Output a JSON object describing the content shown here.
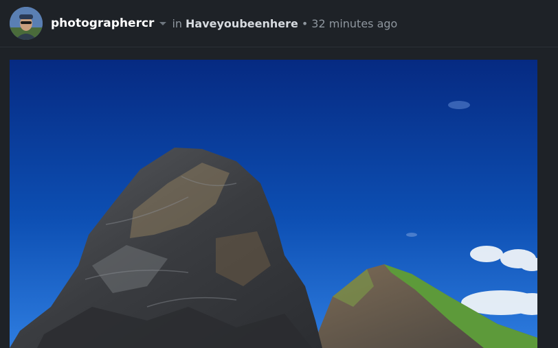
{
  "post": {
    "author": "photographercr",
    "in_label": "in",
    "community": "Haveyoubeenhere",
    "separator": "•",
    "time": "32 minutes ago",
    "avatar_icon": "user-avatar",
    "dropdown_icon": "caret-down-icon",
    "image_subject": "rocky sea stacks under a deep blue sky"
  },
  "colors": {
    "background": "#1e2227",
    "sky_top": "#062a82",
    "sky_bottom": "#2e7de0",
    "rock": "#3c3f44",
    "grass": "#5d9a3a"
  }
}
